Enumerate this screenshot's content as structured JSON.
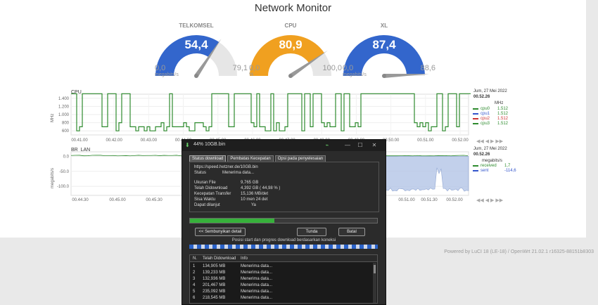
{
  "page": {
    "title": "Network Monitor"
  },
  "gauges": [
    {
      "label": "TELKOMSEL",
      "value": "54,4",
      "min": "0,0",
      "max": "79,1",
      "unit": "megabits/s",
      "level": 0.688,
      "color": "#3366cc"
    },
    {
      "label": "CPU",
      "value": "80,9",
      "min": "0,0",
      "max": "100,0",
      "unit": "%",
      "level": 0.809,
      "color": "#f0a020"
    },
    {
      "label": "XL",
      "value": "87,4",
      "min": "0,0",
      "max": "88,6",
      "unit": "megabits/s",
      "level": 0.986,
      "color": "#3366cc"
    }
  ],
  "cpu_chart": {
    "label": "CPU",
    "ylabel": "MHz",
    "date": "Jum, 27 Mei 2022",
    "time": "00.52.26",
    "unit": "MHz",
    "yticks": [
      "1.400",
      "1.200",
      "1.000",
      "800",
      "600"
    ],
    "xticks": [
      "00.41.00",
      "00.42.00",
      "00.43.00",
      "00.44.00",
      "00.45.00",
      "00.46.00",
      "00.47.00",
      "00.48.00",
      "00.49.00",
      "00.50.00",
      "00.51.00",
      "00.52.00"
    ],
    "series": [
      {
        "name": "cpu0",
        "value": "1.512",
        "color": "#2e8b2e"
      },
      {
        "name": "cpu1",
        "value": "1.512",
        "color": "#3355cc"
      },
      {
        "name": "cpu2",
        "value": "1.512",
        "color": "#cc3333"
      },
      {
        "name": "cpu3",
        "value": "1.512",
        "color": "#2e8b2e"
      }
    ]
  },
  "net_chart": {
    "label": "BR_LAN",
    "ylabel": "megabits/s",
    "date": "Jum, 27 Mei 2022",
    "time": "00.52.26",
    "unit": "megabits/s",
    "yticks": [
      "0.0",
      "-50.0",
      "-100.0"
    ],
    "xticks": [
      "00.44.30",
      "00.45.00",
      "00.45.30",
      "00.46.00",
      "00.51.00",
      "00.51.30",
      "00.52.00"
    ],
    "series": [
      {
        "name": "received",
        "value": "1,7",
        "color": "#2e8b2e"
      },
      {
        "name": "sent",
        "value": "-114,6",
        "color": "#3355cc"
      }
    ]
  },
  "nav_glyphs": "◀◀ ◀ ▶ ▶▶",
  "footer": "Powered by LuCI 18 (LE-18) / OpenWrt 21.02.1 r16325-88151b8303",
  "dialog": {
    "title": "44% 10GB.bin",
    "tabs": [
      "Status download",
      "Pembatas Kecepatan",
      "Opsi pada penyelesaian"
    ],
    "url": "https://speed.hetzner.de/10GB.bin",
    "status_label": "Status",
    "status_value": "Menerima data...",
    "rows": [
      {
        "label": "Ukuran File",
        "value": "9,765  GB"
      },
      {
        "label": "Telah Didownload",
        "value": "4,392  GB  ( 44,98 % )"
      },
      {
        "label": "Kecepatan Transfer",
        "value": "15,136  MB/det"
      },
      {
        "label": "Sisa Waktu",
        "value": "10 men 24 det"
      },
      {
        "label": "Dapat dilanjut",
        "value": "Ya"
      }
    ],
    "progress": 0.4498,
    "hide_button": "<< Sembunyikan detail",
    "pause_button": "Tunda",
    "cancel_button": "Batal",
    "segment_label": "Posisi start dan progres download berdasarkan koneksi",
    "table": {
      "headers": [
        "N.",
        "Telah Didownload",
        "Info"
      ],
      "rows": [
        [
          "1",
          "134,905 MB",
          "Menerima data..."
        ],
        [
          "2",
          "139,233 MB",
          "Menerima data..."
        ],
        [
          "3",
          "132,936 MB",
          "Menerima data..."
        ],
        [
          "4",
          "201,467 MB",
          "Menerima data..."
        ],
        [
          "5",
          "235,092 MB",
          "Menerima data..."
        ],
        [
          "6",
          "218,545 MB",
          "Menerima data..."
        ]
      ]
    }
  }
}
